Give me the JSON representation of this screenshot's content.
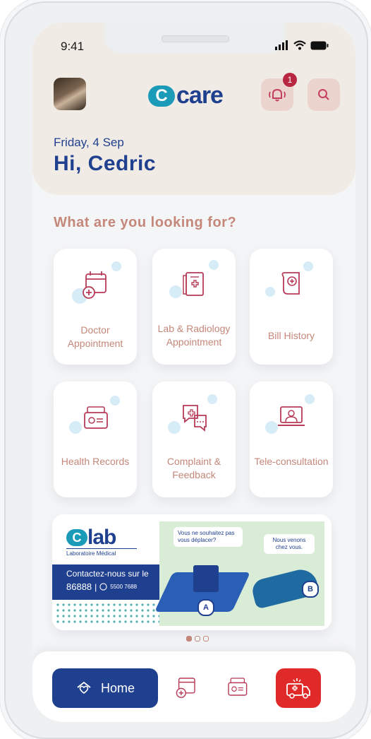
{
  "status_bar": {
    "time": "9:41"
  },
  "header": {
    "logo_mark": "C",
    "logo_text": "care",
    "notification_count": "1",
    "date": "Friday, 4 Sep",
    "greeting": "Hi, Cedric"
  },
  "section": {
    "title": "What are you looking for?"
  },
  "services": [
    {
      "label": "Doctor Appointment",
      "icon": "calendar-plus-icon"
    },
    {
      "label": "Lab & Radiology Appointment",
      "icon": "medical-file-icon"
    },
    {
      "label": "Bill History",
      "icon": "bill-icon"
    },
    {
      "label": "Health Records",
      "icon": "records-folder-icon"
    },
    {
      "label": "Complaint & Feedback",
      "icon": "chat-bubbles-icon"
    },
    {
      "label": "Tele-consultation",
      "icon": "laptop-doctor-icon"
    }
  ],
  "banner": {
    "brand_mark": "C",
    "brand_text": "lab",
    "subtitle": "Laboratoire Médical",
    "contact_line": "Contactez-nous sur le",
    "phone_main": "86888",
    "phone_whatsapp": "5500 7688",
    "bubble_left": "Vous ne souhaitez pas vous déplacer?",
    "bubble_right": "Nous venons chez vous.",
    "point_a": "A",
    "point_b": "B"
  },
  "nav": {
    "home_label": "Home"
  },
  "colors": {
    "primary": "#1f3f8f",
    "accent": "#c4877a",
    "teal": "#1b9bb8",
    "alert": "#e02a2a"
  }
}
